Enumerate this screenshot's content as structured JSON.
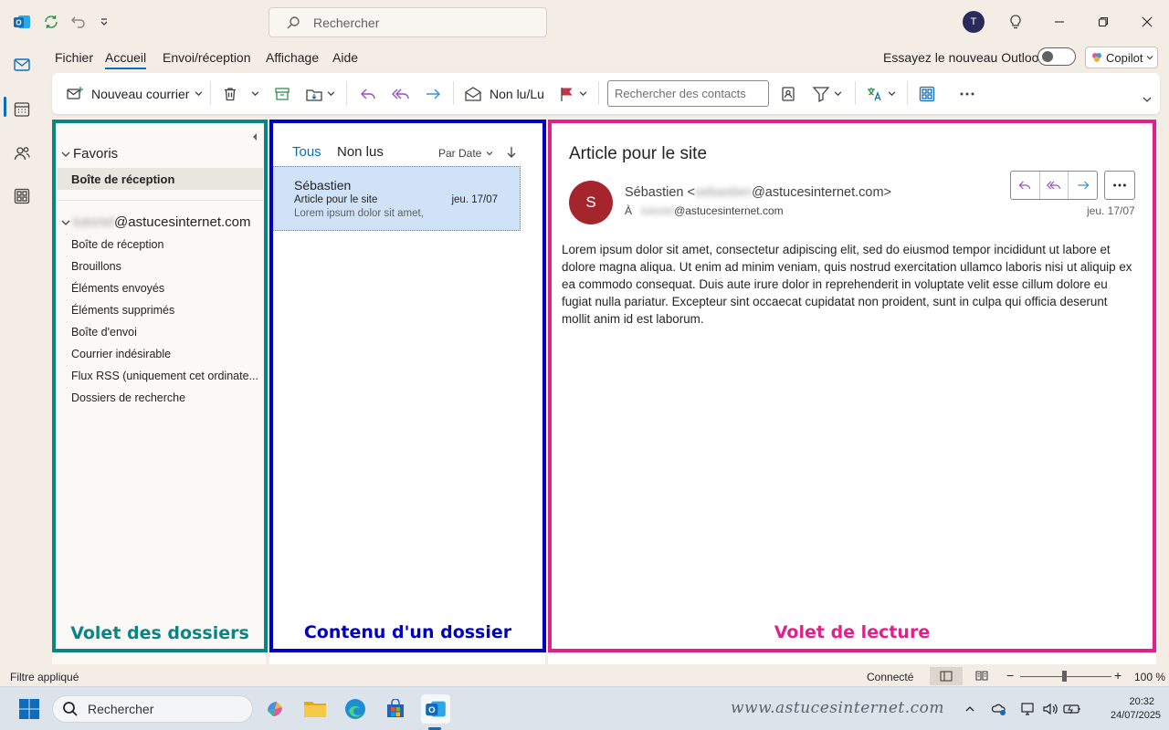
{
  "titlebar": {
    "search_placeholder": "Rechercher",
    "avatar_initial": "T"
  },
  "menu": {
    "tabs": [
      "Fichier",
      "Accueil",
      "Envoi/réception",
      "Affichage",
      "Aide"
    ],
    "active_tab": "Accueil",
    "try_new_label": "Essayez le nouveau Outlook",
    "copilot_label": "Copilot"
  },
  "ribbon": {
    "new_mail_label": "Nouveau courrier",
    "unread_read_label": "Non lu/Lu",
    "contact_search_placeholder": "Rechercher des contacts"
  },
  "folders": {
    "favorites_label": "Favoris",
    "favorite_items": [
      "Boîte de réception"
    ],
    "account_blurred": "tutoriel",
    "account_domain": "@astucesinternet.com",
    "items": [
      "Boîte de réception",
      "Brouillons",
      "Éléments envoyés",
      "Éléments supprimés",
      "Boîte d'envoi",
      "Courrier indésirable",
      "Flux RSS (uniquement cet ordinate...",
      "Dossiers de recherche"
    ]
  },
  "list": {
    "tab_all": "Tous",
    "tab_unread": "Non lus",
    "sort_label": "Par Date",
    "messages": [
      {
        "sender": "Sébastien",
        "subject": "Article pour le site",
        "date": "jeu. 17/07",
        "preview": "Lorem ipsum dolor sit amet,"
      }
    ]
  },
  "reading": {
    "subject": "Article pour le site",
    "avatar_initial": "S",
    "from_name": "Sébastien <",
    "from_blurred": "sebastien",
    "from_domain": "@astucesinternet.com>",
    "to_prefix": "À",
    "to_blurred": "tutoriel",
    "to_domain": "@astucesinternet.com",
    "date": "jeu. 17/07",
    "body": "Lorem ipsum dolor sit amet, consectetur adipiscing elit, sed do eiusmod tempor incididunt ut labore et dolore magna aliqua. Ut enim ad minim veniam, quis nostrud exercitation ullamco laboris nisi ut aliquip ex ea commodo consequat. Duis aute irure dolor in reprehenderit in voluptate velit esse cillum dolore eu fugiat nulla pariatur. Excepteur sint occaecat cupidatat non proident, sunt in culpa qui officia deserunt mollit anim id est laborum."
  },
  "annotations": {
    "folders_caption": "Volet des dossiers",
    "list_caption": "Contenu d'un dossier",
    "reading_caption": "Volet de lecture",
    "colors": {
      "folders": "#0a8584",
      "list": "#0000c0",
      "reading": "#e0218a"
    }
  },
  "statusbar": {
    "filter_label": "Filtre appliqué",
    "connection_label": "Connecté",
    "zoom_label": "100 %",
    "zoom_level_percent": 100
  },
  "taskbar": {
    "search_label": "Rechercher",
    "watermark": "www.astucesinternet.com",
    "time": "20:32",
    "date": "24/07/2025"
  },
  "colors": {
    "accent": "#0f6cbd",
    "selected_message_bg": "#cfe2f7",
    "sender_avatar": "#a4262c",
    "background": "#f3ede6"
  }
}
